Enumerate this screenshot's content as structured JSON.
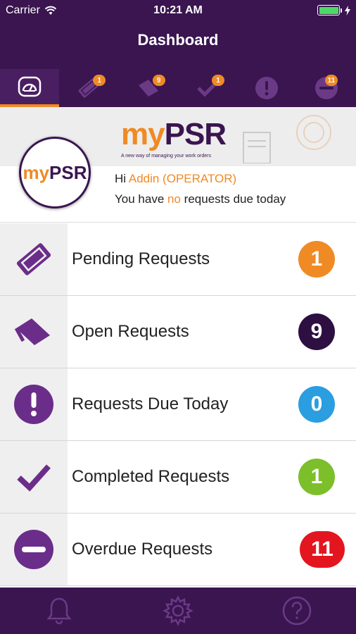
{
  "status_bar": {
    "carrier": "Carrier",
    "time": "10:21 AM"
  },
  "header": {
    "title": "Dashboard"
  },
  "tabs": [
    {
      "icon": "speedometer-icon",
      "badge": ""
    },
    {
      "icon": "ticket-icon",
      "badge": "1"
    },
    {
      "icon": "flag-icon",
      "badge": "9"
    },
    {
      "icon": "checkmark-icon",
      "badge": "1"
    },
    {
      "icon": "exclamation-icon",
      "badge": ""
    },
    {
      "icon": "minus-circle-icon",
      "badge": "11"
    }
  ],
  "banner": {
    "logo_my": "my",
    "logo_psr": "PSR",
    "tagline": "A new way of managing your work orders"
  },
  "user": {
    "greeting": "Hi",
    "name": "Addin (OPERATOR)",
    "due_prefix": "You have",
    "due_highlight": "no",
    "due_suffix": "requests due today"
  },
  "requests": [
    {
      "label": "Pending Requests",
      "count": "1",
      "color": "#f08a24",
      "icon": "ticket-icon"
    },
    {
      "label": "Open Requests",
      "count": "9",
      "color": "#2d0f42",
      "icon": "flag-icon"
    },
    {
      "label": "Requests Due Today",
      "count": "0",
      "color": "#2a9ee0",
      "icon": "exclamation-icon"
    },
    {
      "label": "Completed Requests",
      "count": "1",
      "color": "#7cbf2a",
      "icon": "checkmark-icon"
    },
    {
      "label": "Overdue Requests",
      "count": "11",
      "color": "#e3161f",
      "icon": "minus-circle-icon"
    }
  ],
  "bottom_nav": [
    {
      "icon": "bell-icon"
    },
    {
      "icon": "gear-icon"
    },
    {
      "icon": "help-icon"
    }
  ],
  "colors": {
    "brand_purple": "#3a1550",
    "accent_orange": "#f08a24"
  }
}
